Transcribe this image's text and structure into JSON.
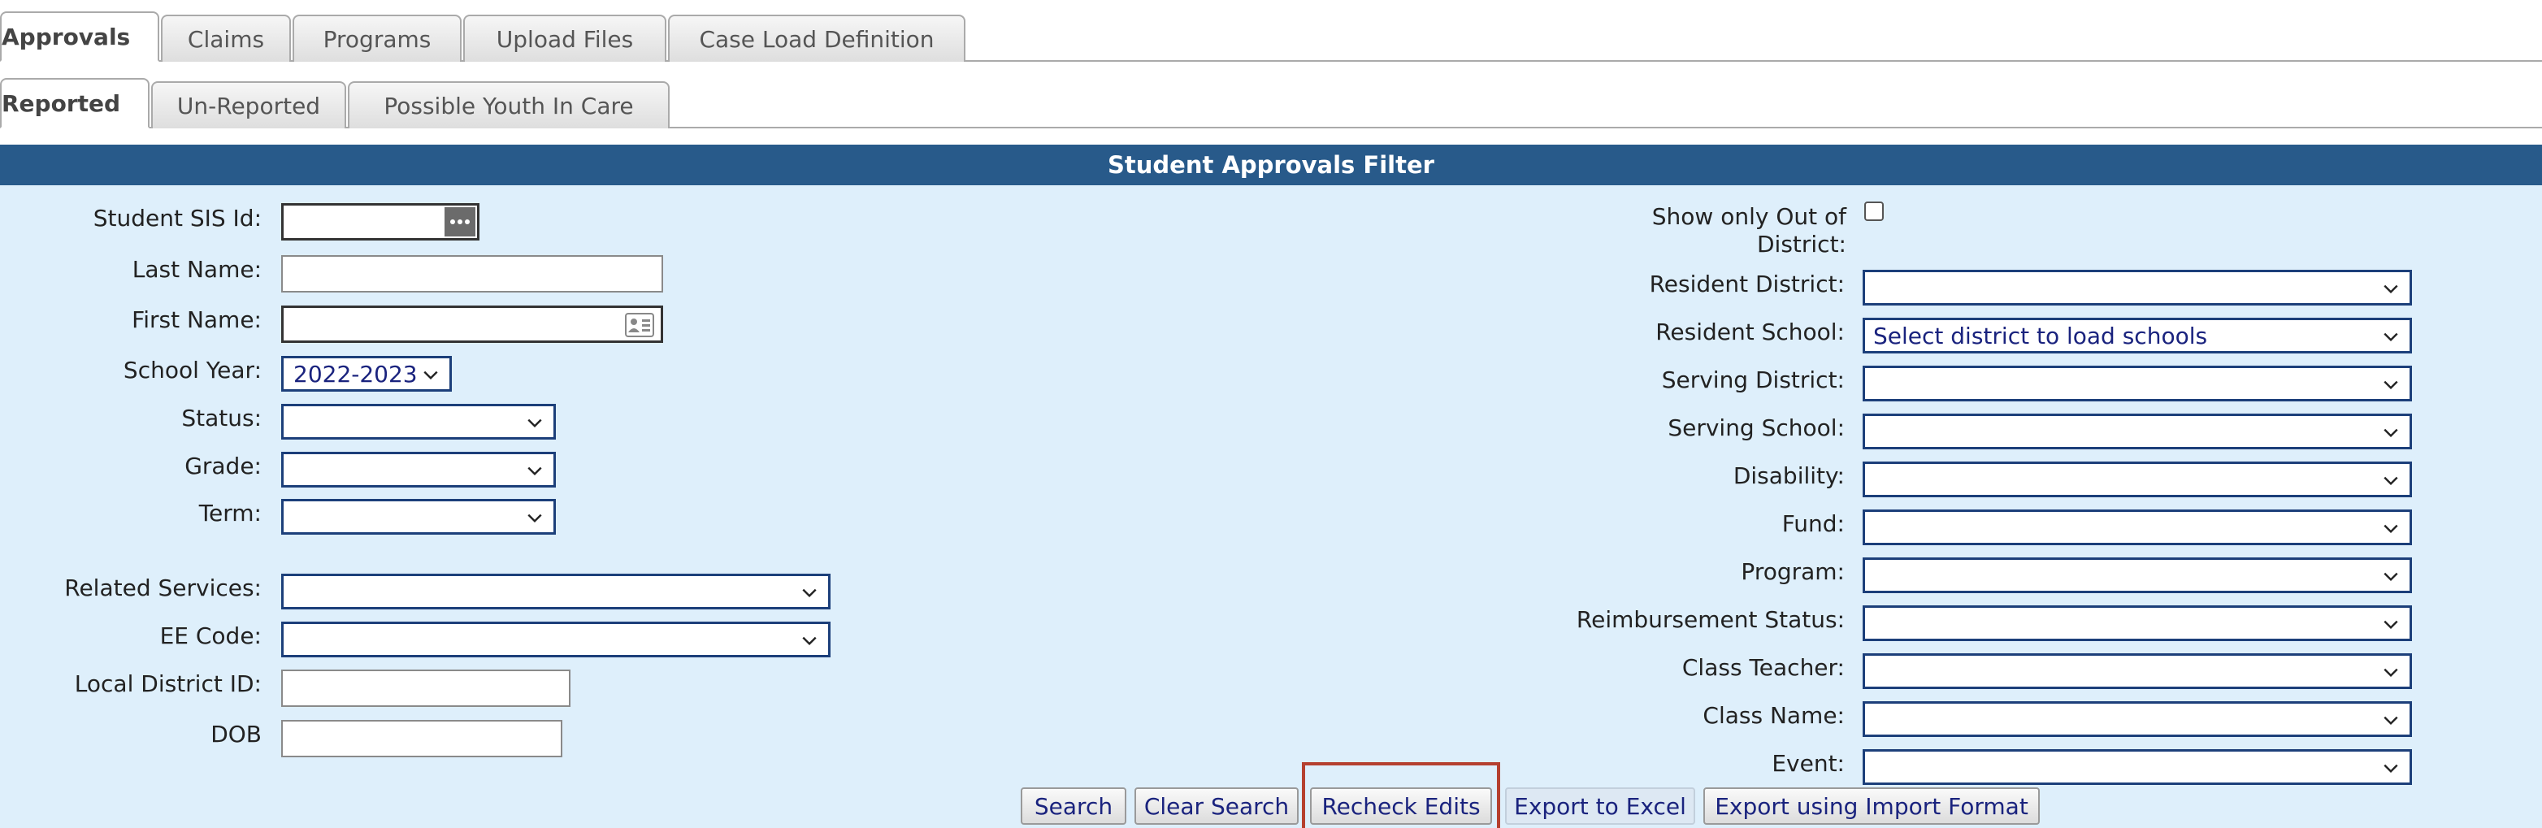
{
  "tabs_primary": [
    {
      "label": "Approvals",
      "active": true
    },
    {
      "label": "Claims",
      "active": false
    },
    {
      "label": "Programs",
      "active": false
    },
    {
      "label": "Upload Files",
      "active": false
    },
    {
      "label": "Case Load Definition",
      "active": false
    }
  ],
  "tabs_secondary": [
    {
      "label": "Reported",
      "active": true
    },
    {
      "label": "Un-Reported",
      "active": false
    },
    {
      "label": "Possible Youth In Care",
      "active": false
    }
  ],
  "filter": {
    "title": "Student Approvals Filter",
    "left": {
      "student_sis_id": {
        "label": "Student SIS Id:",
        "value": ""
      },
      "last_name": {
        "label": "Last Name:",
        "value": ""
      },
      "first_name": {
        "label": "First Name:",
        "value": ""
      },
      "school_year": {
        "label": "School Year:",
        "value": "2022-2023"
      },
      "status": {
        "label": "Status:",
        "value": ""
      },
      "grade": {
        "label": "Grade:",
        "value": ""
      },
      "term": {
        "label": "Term:",
        "value": ""
      },
      "related_services": {
        "label": "Related Services:",
        "value": ""
      },
      "ee_code": {
        "label": "EE Code:",
        "value": ""
      },
      "local_district_id": {
        "label": "Local District ID:",
        "value": ""
      },
      "dob": {
        "label": "DOB",
        "value": ""
      }
    },
    "right": {
      "show_out_of_district": {
        "label": "Show only Out of District:",
        "checked": false
      },
      "resident_district": {
        "label": "Resident District:",
        "value": ""
      },
      "resident_school": {
        "label": "Resident School:",
        "value": "Select district to load schools"
      },
      "serving_district": {
        "label": "Serving District:",
        "value": ""
      },
      "serving_school": {
        "label": "Serving School:",
        "value": ""
      },
      "disability": {
        "label": "Disability:",
        "value": ""
      },
      "fund": {
        "label": "Fund:",
        "value": ""
      },
      "program": {
        "label": "Program:",
        "value": ""
      },
      "reimbursement_status": {
        "label": "Reimbursement Status:",
        "value": ""
      },
      "class_teacher": {
        "label": "Class Teacher:",
        "value": ""
      },
      "class_name": {
        "label": "Class Name:",
        "value": ""
      },
      "event": {
        "label": "Event:",
        "value": ""
      }
    }
  },
  "buttons": {
    "search": "Search",
    "clear_search": "Clear Search",
    "recheck_edits": "Recheck Edits",
    "export_excel": "Export to Excel",
    "export_import_format": "Export using Import Format"
  },
  "colors": {
    "header_bg": "#285a8a",
    "panel_bg": "#deeffb",
    "link_text": "#1a237e",
    "highlight": "#b5402f"
  },
  "icons": {
    "sis_lookup": "ellipsis-icon",
    "first_name_card": "contact-card-icon",
    "dropdown": "chevron-down-icon"
  }
}
